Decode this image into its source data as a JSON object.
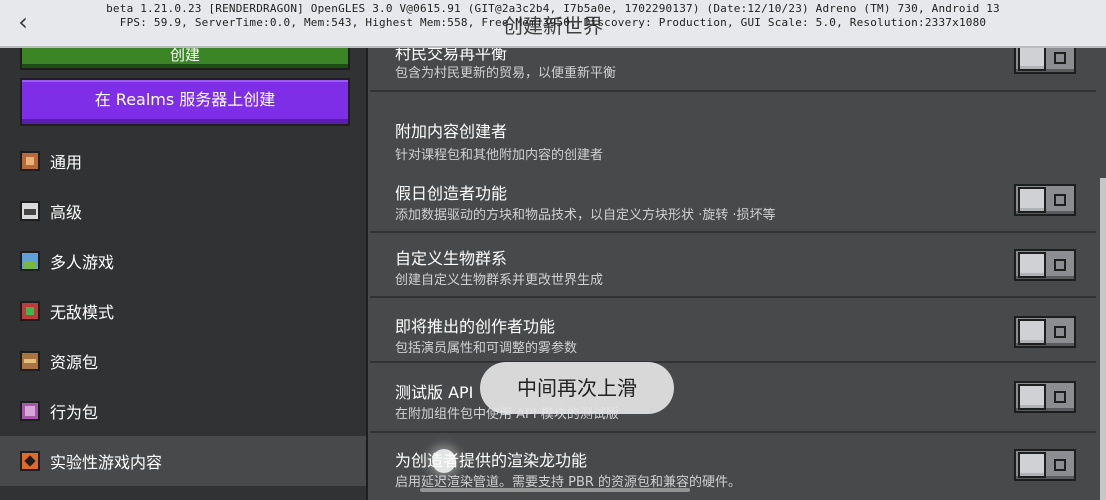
{
  "header": {
    "back_icon": "chevron-left-icon",
    "title": "创建新世界",
    "debug_line1": "beta 1.21.0.23 [RENDERDRAGON] OpenGLES 3.0 V@0615.91 (GIT@2a3c2b4, I7b5a0e, 1702290137) (Date:12/10/23) Adreno (TM) 730, Android 13",
    "debug_line2": "FPS: 59.9, ServerTime:0.0, Mem:543, Highest Mem:558, Free Mem:3950, Discovery: Production, GUI Scale: 5.0, Resolution:2337x1080"
  },
  "sidebar": {
    "create_label": "创建",
    "realms_label": "在 Realms 服务器上创建",
    "items": [
      {
        "label": "通用",
        "icon": "general-icon"
      },
      {
        "label": "高级",
        "icon": "advanced-icon"
      },
      {
        "label": "多人游戏",
        "icon": "multiplayer-icon"
      },
      {
        "label": "无敌模式",
        "icon": "cheats-icon"
      },
      {
        "label": "资源包",
        "icon": "resource-pack-icon"
      },
      {
        "label": "行为包",
        "icon": "behavior-pack-icon"
      },
      {
        "label": "实验性游戏内容",
        "icon": "experiments-icon",
        "selected": true
      }
    ]
  },
  "settings": [
    {
      "title": "村民交易再平衡",
      "desc": "包含为村民更新的贸易，以便重新平衡",
      "toggle": false
    },
    {
      "title": "附加内容创建者",
      "desc": "针对课程包和其他附加内容的创建者"
    },
    {
      "title": "假日创造者功能",
      "desc": "添加数据驱动的方块和物品技术，以自定义方块形状 ·旋转 ·损坏等",
      "toggle": false
    },
    {
      "title": "自定义生物群系",
      "desc": "创建自定义生物群系并更改世界生成",
      "toggle": false
    },
    {
      "title": "即将推出的创作者功能",
      "desc": "包括演员属性和可调整的雾参数",
      "toggle": false
    },
    {
      "title": "测试版 API",
      "desc": "在附加组件包中使用 API 模块的测试版",
      "toggle": false
    },
    {
      "title": "为创造者提供的渲染龙功能",
      "desc": "启用延迟渲染管道。需要支持 PBR 的资源包和兼容的硬件。",
      "toggle": false
    }
  ],
  "overlay": {
    "hint_text": "中间再次上滑"
  },
  "colors": {
    "create_green": "#3c8527",
    "realms_purple": "#7d2ee6",
    "panel_bg": "#48494a",
    "sidebar_bg": "#313233"
  }
}
